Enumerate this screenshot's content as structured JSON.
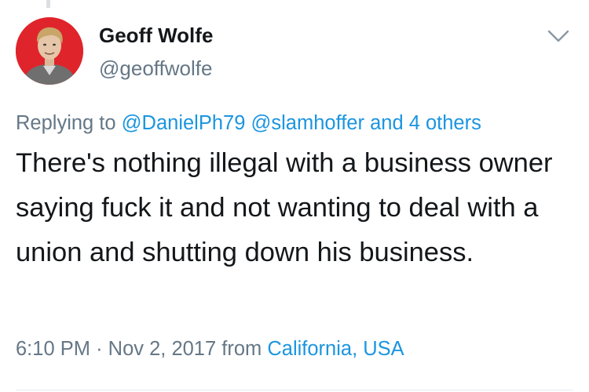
{
  "tweet": {
    "author_name": "Geoff Wolfe",
    "author_handle": "@geoffwolfe",
    "reply_prefix": "Replying to",
    "reply_mentions": [
      "@DanielPh79",
      "@slamhoffer"
    ],
    "reply_others": "and 4 others",
    "text": "There's nothing illegal with a business owner saying fuck it and not wanting to deal with a union and shutting down his business.",
    "time": "6:10 PM",
    "separator": "·",
    "date": "Nov 2, 2017",
    "from_label": "from",
    "location": "California, USA"
  },
  "icons": {
    "menu": "chevron-down-icon",
    "avatar": "avatar"
  },
  "colors": {
    "text": "#14171a",
    "secondary": "#657786",
    "link": "#1b95e0",
    "avatar_bg": "#e0242b"
  }
}
